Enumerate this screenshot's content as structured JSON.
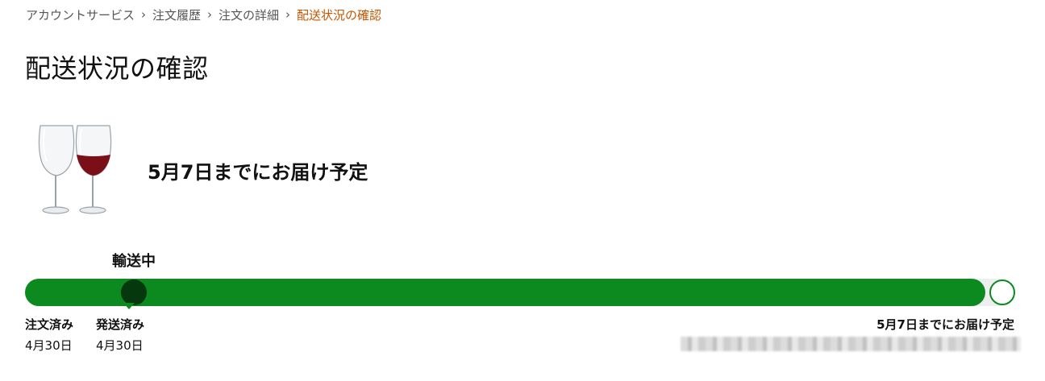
{
  "breadcrumb": {
    "items": [
      "アカウントサービス",
      "注文履歴",
      "注文の詳細"
    ],
    "current": "配送状況の確認",
    "separator": "›"
  },
  "page": {
    "title": "配送状況の確認"
  },
  "shipment": {
    "estimate_heading": "5月7日までにお届け予定",
    "status": "輸送中",
    "progress_fraction": 0.97,
    "current_position_fraction": 0.11,
    "milestones": {
      "ordered": {
        "label": "注文済み",
        "date": "4月30日"
      },
      "shipped": {
        "label": "発送済み",
        "date": "4月30日"
      },
      "delivery": {
        "label": "5月7日までにお届け予定"
      }
    }
  },
  "colors": {
    "accent_link": "#c45500",
    "progress_fill": "#0c8a1f",
    "current_marker": "#06380e",
    "track_background": "#eeeeee"
  },
  "icons": {
    "product": "wine-glasses-image"
  }
}
